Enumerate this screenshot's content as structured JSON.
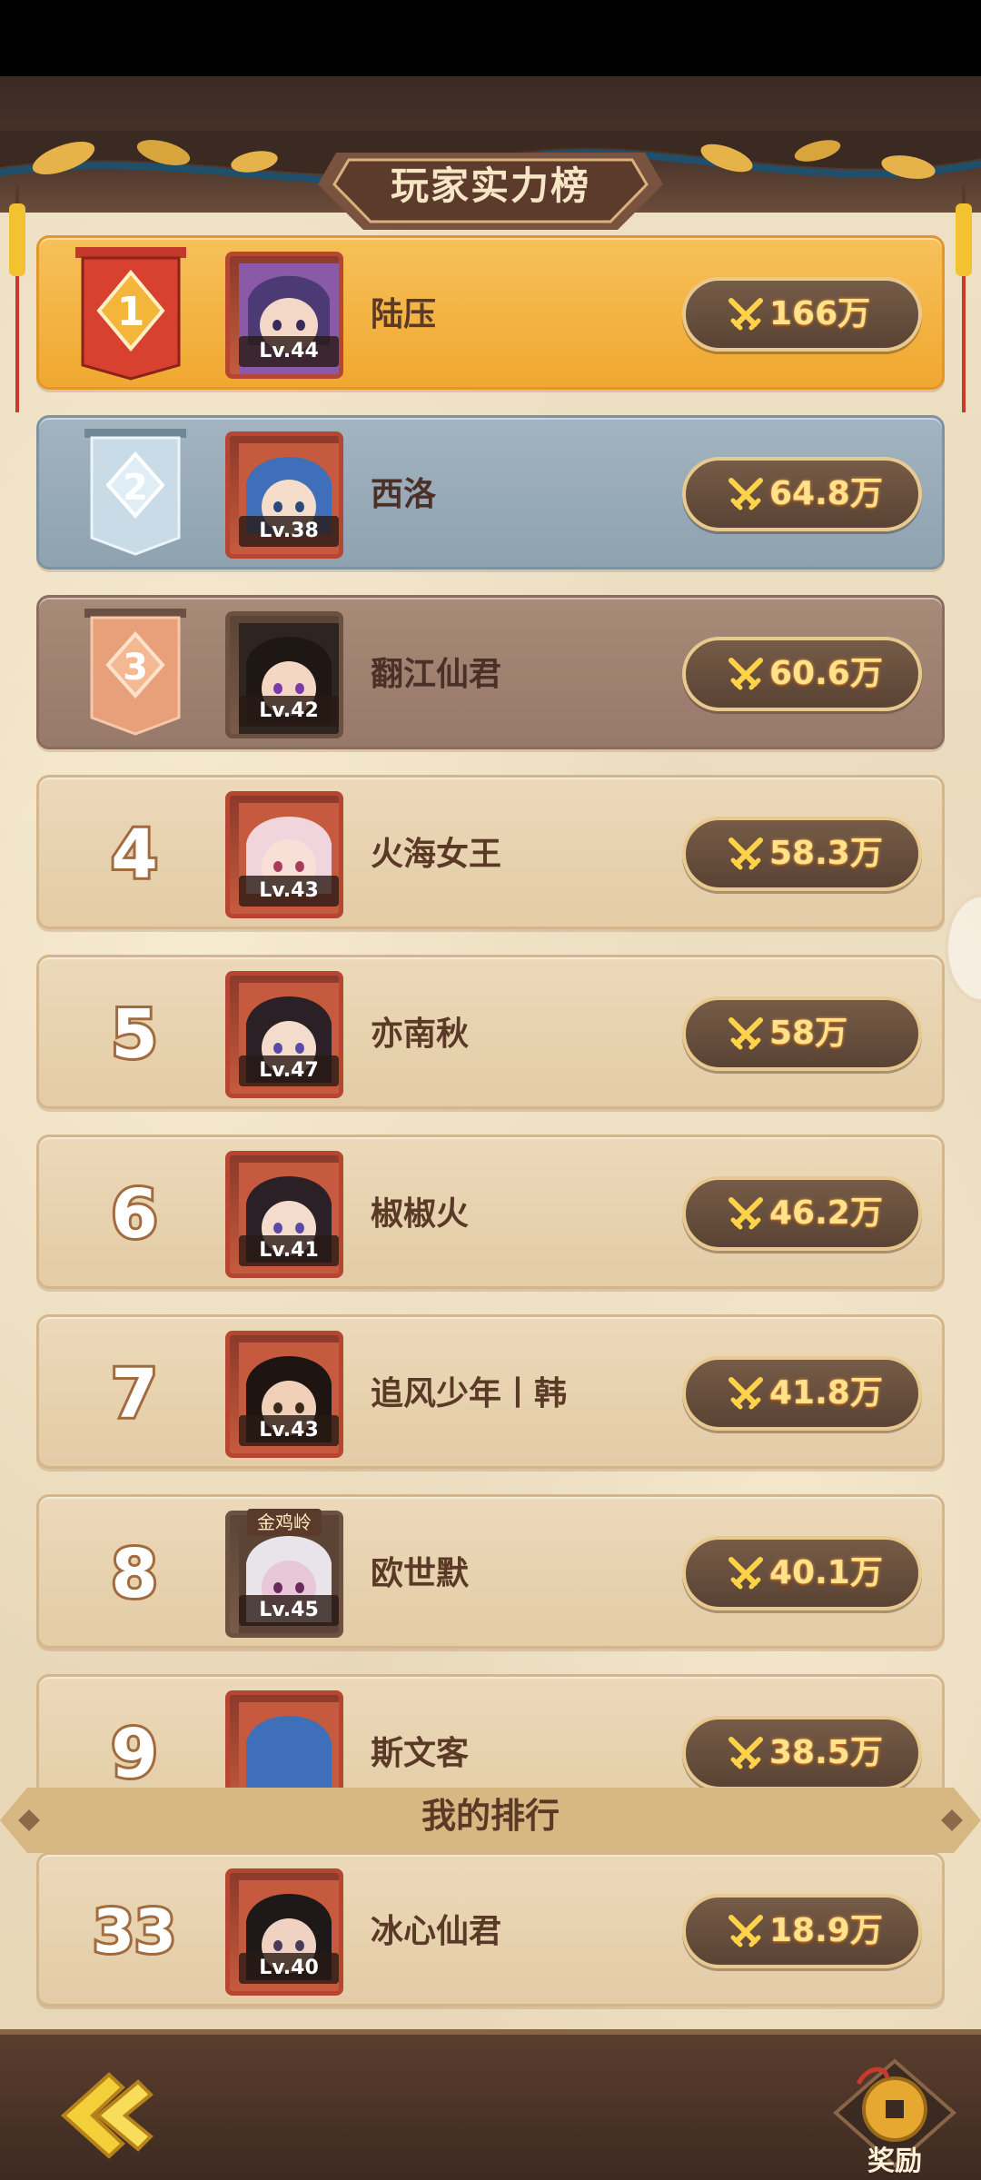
{
  "title": "玩家实力榜",
  "rows": [
    {
      "rank": "1",
      "name": "陆压",
      "level": "Lv.44",
      "power": "166万",
      "tag": ""
    },
    {
      "rank": "2",
      "name": "西洛",
      "level": "Lv.38",
      "power": "64.8万",
      "tag": ""
    },
    {
      "rank": "3",
      "name": "翻江仙君",
      "level": "Lv.42",
      "power": "60.6万",
      "tag": ""
    },
    {
      "rank": "4",
      "name": "火海女王",
      "level": "Lv.43",
      "power": "58.3万",
      "tag": ""
    },
    {
      "rank": "5",
      "name": "亦南秋",
      "level": "Lv.47",
      "power": "58万",
      "tag": ""
    },
    {
      "rank": "6",
      "name": "椒椒火",
      "level": "Lv.41",
      "power": "46.2万",
      "tag": ""
    },
    {
      "rank": "7",
      "name": "追风少年丨韩",
      "level": "Lv.43",
      "power": "41.8万",
      "tag": ""
    },
    {
      "rank": "8",
      "name": "欧世默",
      "level": "Lv.45",
      "power": "40.1万",
      "tag": "金鸡岭"
    },
    {
      "rank": "9",
      "name": "斯文客",
      "level": "",
      "power": "38.5万",
      "tag": ""
    }
  ],
  "my_ranking": {
    "label": "我的排行",
    "rank": "33",
    "name": "冰心仙君",
    "level": "Lv.40",
    "power": "18.9万"
  },
  "footer": {
    "reward_label": "奖励"
  },
  "colors": {
    "gold": "#f0a830",
    "silver": "#8ea2b0",
    "bronze": "#98796a",
    "power_text": "#ffe28a"
  }
}
